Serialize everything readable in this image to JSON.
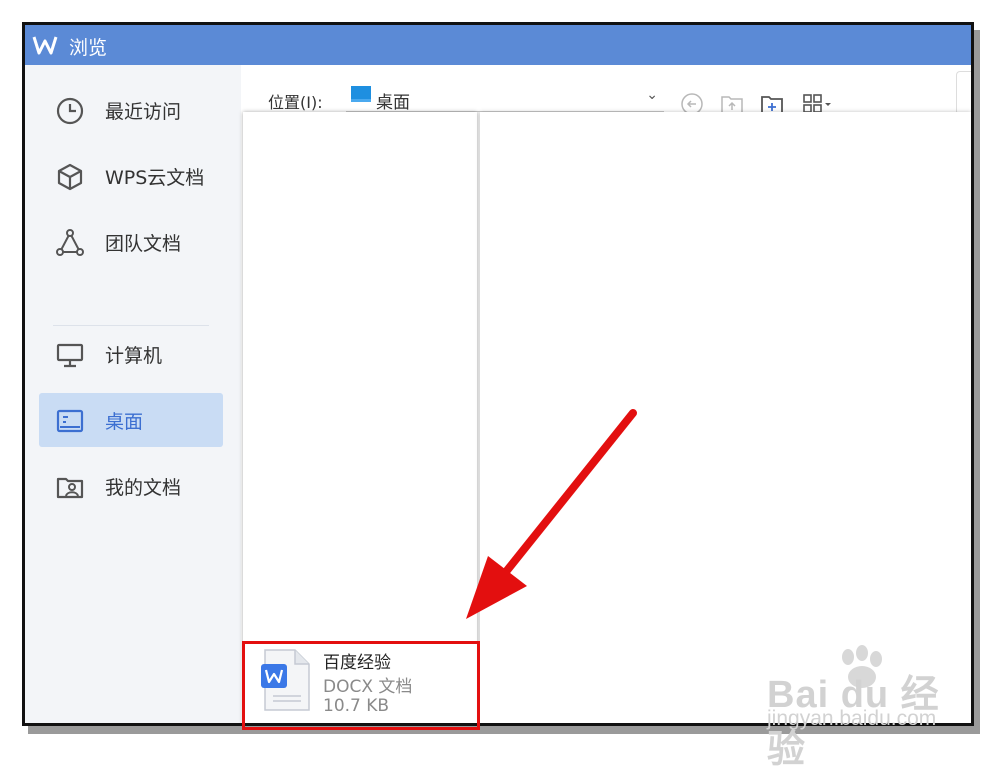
{
  "window": {
    "title": "浏览",
    "logo_icon": "wps-logo-icon"
  },
  "sidebar": {
    "items": [
      {
        "label": "最近访问",
        "icon": "clock-icon",
        "active": false
      },
      {
        "label": "WPS云文档",
        "icon": "cube-icon",
        "active": false
      },
      {
        "label": "团队文档",
        "icon": "team-icon",
        "active": false
      },
      {
        "label": "计算机",
        "icon": "monitor-icon",
        "active": false
      },
      {
        "label": "桌面",
        "icon": "desktop-icon",
        "active": true
      },
      {
        "label": "我的文档",
        "icon": "user-folder-icon",
        "active": false
      }
    ]
  },
  "location": {
    "label": "位置(I):",
    "value": "桌面"
  },
  "toolbar": {
    "icons": [
      "back-icon",
      "up-folder-icon",
      "new-folder-icon",
      "view-grid-icon"
    ]
  },
  "file": {
    "name": "百度经验",
    "type": "DOCX 文档",
    "size": "10.7 KB",
    "icon": "docx-file-icon"
  },
  "watermark": {
    "brand": "Bai du 经验",
    "site": "jingyan.baidu.com"
  },
  "colors": {
    "titlebar": "#5b8ad6",
    "accent": "#3c6fd1",
    "active_bg": "#c9dcf4",
    "annotation": "#e30f0f"
  }
}
